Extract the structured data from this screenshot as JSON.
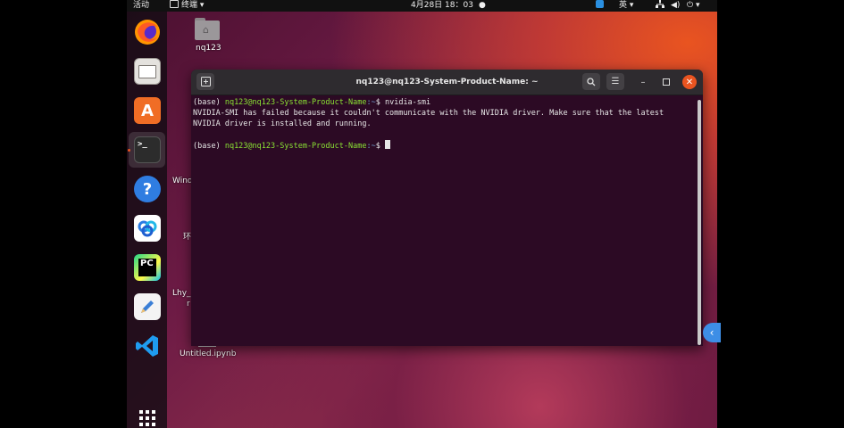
{
  "topbar": {
    "activities": "活动",
    "app_menu": "终端",
    "clock": "4月28日 18：03",
    "input_method": "英",
    "icons": [
      "network-icon",
      "volume-icon",
      "power-icon"
    ]
  },
  "dock": {
    "items": [
      "firefox",
      "files",
      "ubuntu-software",
      "terminal",
      "help",
      "baidu-netdisk",
      "pycharm",
      "text-editor",
      "vscode"
    ],
    "show_apps": "show-applications"
  },
  "desktop": {
    "icons": [
      {
        "label": "nq123"
      },
      {
        "label": "Windc"
      },
      {
        "label": "环"
      },
      {
        "label": "Lhy_"
      },
      {
        "label": "r"
      },
      {
        "label": "Untitled.ipynb"
      }
    ]
  },
  "terminal": {
    "title": "nq123@nq123-System-Product-Name: ~",
    "lines": [
      {
        "env": "(base) ",
        "userhost": "nq123@nq123-System-Product-Name",
        "path": ":~",
        "sym": "$ ",
        "cmd": "nvidia-smi"
      },
      {
        "output": "NVIDIA-SMI has failed because it couldn't communicate with the NVIDIA driver. Make sure that the latest NVIDIA driver is installed and running."
      },
      {
        "env": "(base) ",
        "userhost": "nq123@nq123-System-Product-Name",
        "path": ":~",
        "sym": "$ ",
        "cmd": ""
      }
    ]
  }
}
